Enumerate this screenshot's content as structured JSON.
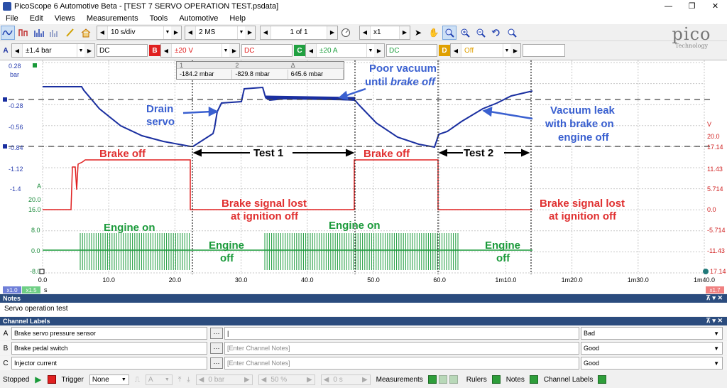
{
  "window": {
    "title": "PicoScope 6 Automotive Beta - [TEST 7 SERVO OPERATION TEST.psdata]",
    "min": "—",
    "restore": "❐",
    "close": "✕"
  },
  "menu": [
    "File",
    "Edit",
    "Views",
    "Measurements",
    "Tools",
    "Automotive",
    "Help"
  ],
  "toolbar": {
    "timebase": "10 s/div",
    "samples": "2 MS",
    "page": "1 of 1",
    "zoom": "x1"
  },
  "logo": {
    "text": "pico",
    "sub": "Technology"
  },
  "channels_bar": [
    {
      "letter": "A",
      "range": "±1.4 bar",
      "coupling": "DC",
      "color": "#1a2fa0"
    },
    {
      "letter": "B",
      "range": "±20 V",
      "coupling": "DC",
      "color": "#e02020"
    },
    {
      "letter": "C",
      "range": "±20 A",
      "coupling": "DC",
      "color": "#20a040"
    },
    {
      "letter": "D",
      "range": "Off",
      "coupling": "",
      "color": "#e0a000"
    }
  ],
  "ruler_box": {
    "headers": [
      "1",
      "2",
      "Δ"
    ],
    "values": [
      "-184.2 mbar",
      "-829.8 mbar",
      "645.6 mbar"
    ]
  },
  "axes": {
    "a_unit": "bar",
    "a_ticks": [
      "0.28",
      "-0.28",
      "-0.56",
      "-0.84",
      "-1.12",
      "-1.4"
    ],
    "a_top_marker": "0.28",
    "c_unit": "A",
    "c_ticks": [
      "20.0",
      "16.0",
      "8.0",
      "0.0",
      "-8.0"
    ],
    "b_unit": "V",
    "b_ticks": [
      "20.0",
      "17.14",
      "11.43",
      "5.714",
      "0.0",
      "-5.714",
      "-11.43",
      "17.14"
    ],
    "x_ticks": [
      "0.0",
      "10.0",
      "20.0",
      "30.0",
      "40.0",
      "50.0",
      "60.0",
      "1m10.0",
      "1m20.0",
      "1m30.0",
      "1m40.0"
    ],
    "x_unit": "s",
    "badge_left_a": "x1.0",
    "badge_left_c": "x1.5",
    "badge_right": "x1.7"
  },
  "annotations": {
    "drain": [
      "Drain",
      "servo"
    ],
    "poor": [
      "Poor vacuum",
      "until ",
      "brake off"
    ],
    "leak": [
      "Vacuum leak",
      "with brake on",
      "engine off"
    ],
    "brake_off_1": "Brake off",
    "brake_off_2": "Brake off",
    "test1": "Test 1",
    "test2": "Test 2",
    "signal_lost_1": [
      "Brake signal lost",
      "at ignition off"
    ],
    "signal_lost_2": [
      "Brake signal lost",
      "at ignition off"
    ],
    "engine_on_1": "Engine on",
    "engine_on_2": "Engine on",
    "engine_off_1": [
      "Engine",
      "off"
    ],
    "engine_off_2": [
      "Engine",
      "off"
    ]
  },
  "notes": {
    "header": "Notes",
    "text": "Servo operation test"
  },
  "channel_labels": {
    "header": "Channel Labels",
    "rows": [
      {
        "letter": "A",
        "name": "Brake servo pressure sensor",
        "notes": "|",
        "status": "Bad"
      },
      {
        "letter": "B",
        "name": "Brake pedal switch",
        "notes": "[Enter Channel Notes]",
        "status": "Good"
      },
      {
        "letter": "C",
        "name": "Injector current",
        "notes": "[Enter Channel Notes]",
        "status": "Good"
      }
    ]
  },
  "statusbar": {
    "state": "Stopped",
    "trigger_label": "Trigger",
    "trigger_mode": "None",
    "trig_channel": "A",
    "trig_level": "0 bar",
    "trig_pct": "50 %",
    "trig_time": "0 s",
    "measurements": "Measurements",
    "rulers": "Rulers",
    "notes": "Notes",
    "channel_labels": "Channel Labels"
  },
  "colors": {
    "blue": "#1a2fa0",
    "red": "#e02020",
    "green": "#1a9a3a",
    "annot_blue": "#3a60d0"
  }
}
